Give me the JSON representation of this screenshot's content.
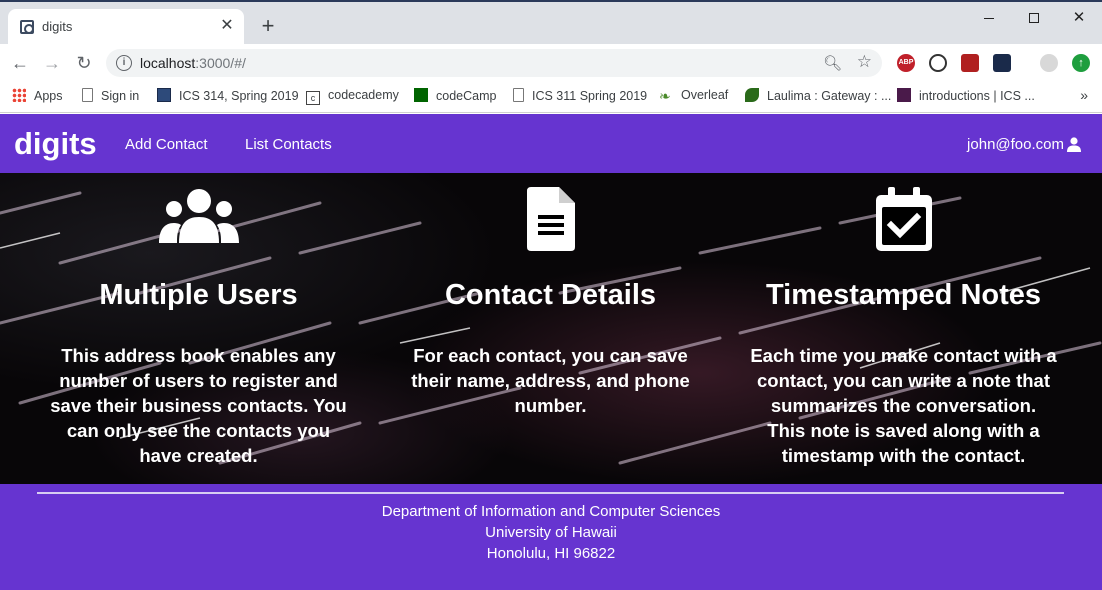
{
  "browser": {
    "tab_title": "digits",
    "url_host": "localhost",
    "url_rest": ":3000/#/",
    "bookmarks": [
      {
        "label": "Apps"
      },
      {
        "label": "Sign in"
      },
      {
        "label": "ICS 314, Spring 2019"
      },
      {
        "label": "codecademy"
      },
      {
        "label": "codeCamp"
      },
      {
        "label": "ICS 311 Spring 2019"
      },
      {
        "label": "Overleaf"
      },
      {
        "label": "Laulima : Gateway : ..."
      },
      {
        "label": "introductions | ICS ..."
      }
    ]
  },
  "nav": {
    "brand": "digits",
    "links": [
      {
        "label": "Add Contact"
      },
      {
        "label": "List Contacts"
      }
    ],
    "user": "john@foo.com"
  },
  "features": [
    {
      "icon": "users-icon",
      "title": "Multiple Users",
      "text": "This address book enables any number of users to register and save their business contacts. You can only see the contacts you have created."
    },
    {
      "icon": "file-text-icon",
      "title": "Contact Details",
      "text": "For each contact, you can save their name, address, and phone number."
    },
    {
      "icon": "calendar-check-icon",
      "title": "Timestamped Notes",
      "text": "Each time you make contact with a contact, you can write a note that summarizes the conversation. This note is saved along with a timestamp with the contact."
    }
  ],
  "footer": {
    "line1": "Department of Information and Computer Sciences",
    "line2": "University of Hawaii",
    "line3": "Honolulu, HI 96822"
  },
  "colors": {
    "brand_purple": "#6634d0",
    "hero_dark": "#080608"
  }
}
